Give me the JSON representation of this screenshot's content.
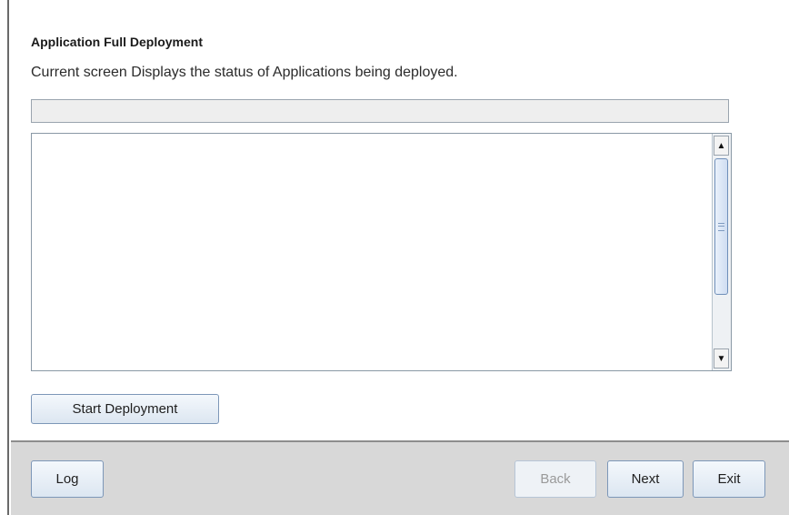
{
  "page": {
    "title": "Application Full Deployment",
    "subtitle": "Current screen Displays the status of Applications being deployed."
  },
  "progress": {
    "value": 0
  },
  "log_area": {
    "text": ""
  },
  "scrollbar": {
    "up_icon": "▲",
    "down_icon": "▼"
  },
  "actions": {
    "start_label": "Start Deployment"
  },
  "footer": {
    "log_label": "Log",
    "back_label": "Back",
    "next_label": "Next",
    "exit_label": "Exit",
    "back_enabled": false
  }
}
